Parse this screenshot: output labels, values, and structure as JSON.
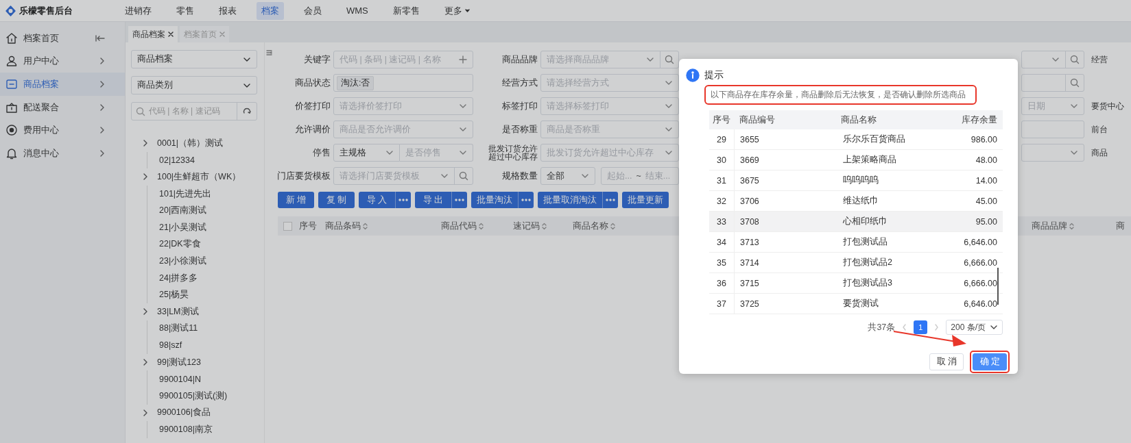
{
  "app": {
    "logo_text": "乐檬零售后台"
  },
  "top_nav": [
    {
      "label": "进销存",
      "selected": false,
      "kind": "link"
    },
    {
      "label": "零售",
      "selected": false,
      "kind": "link"
    },
    {
      "label": "报表",
      "selected": false,
      "kind": "link"
    },
    {
      "label": "档案",
      "selected": true,
      "kind": "link"
    },
    {
      "label": "会员",
      "selected": false,
      "kind": "link"
    },
    {
      "label": "WMS",
      "selected": false,
      "kind": "link"
    },
    {
      "label": "新零售",
      "selected": false,
      "kind": "link"
    },
    {
      "label": "更多",
      "selected": false,
      "kind": "dropdown"
    }
  ],
  "sidebar": {
    "items": [
      {
        "label": "档案首页",
        "selected": false,
        "kind": "collapse"
      },
      {
        "label": "用户中心",
        "selected": false,
        "kind": "menu"
      },
      {
        "label": "商品档案",
        "selected": true,
        "kind": "menu"
      },
      {
        "label": "配送聚合",
        "selected": false,
        "kind": "menu"
      },
      {
        "label": "费用中心",
        "selected": false,
        "kind": "menu"
      },
      {
        "label": "消息中心",
        "selected": false,
        "kind": "menu"
      }
    ]
  },
  "tabs": [
    {
      "label": "商品档案",
      "selected": true
    },
    {
      "label": "档案首页",
      "selected": false
    }
  ],
  "tree_panel": {
    "selects": [
      "商品档案",
      "商品类别"
    ],
    "search_placeholder": "代码 | 名称 | 速记码",
    "nodes": [
      {
        "label": "0001|（韩）测试",
        "has_children": true
      },
      {
        "label": "02|12334",
        "has_children": false
      },
      {
        "label": "100|生鲜超市（WK）",
        "has_children": true
      },
      {
        "label": "101|先进先出",
        "has_children": false
      },
      {
        "label": "20|西南测试",
        "has_children": false
      },
      {
        "label": "21|小吴测试",
        "has_children": false
      },
      {
        "label": "22|DK零食",
        "has_children": false
      },
      {
        "label": "23|小徐测试",
        "has_children": false
      },
      {
        "label": "24|拼多多",
        "has_children": false
      },
      {
        "label": "25|杨昊",
        "has_children": false
      },
      {
        "label": "33|LM测试",
        "has_children": true
      },
      {
        "label": "88|测试11",
        "has_children": false
      },
      {
        "label": "98|szf",
        "has_children": false
      },
      {
        "label": "99|测试123",
        "has_children": true
      },
      {
        "label": "9900104|N",
        "has_children": false
      },
      {
        "label": "9900105|测试(测)",
        "has_children": false
      },
      {
        "label": "9900106|食品",
        "has_children": true
      },
      {
        "label": "9900108|南京",
        "has_children": false
      }
    ]
  },
  "filter_rows": [
    {
      "left": {
        "label": "关键字",
        "kind": "text_add",
        "placeholder": "代码 | 条码 | 速记码 | 名称"
      },
      "right": {
        "label": "商品品牌",
        "kind": "select",
        "placeholder": "请选择商品品牌",
        "search": true
      },
      "edge_field": {
        "kind": "select",
        "search": true
      },
      "edge_label": "经营"
    },
    {
      "left": {
        "label": "商品状态",
        "kind": "tag",
        "value": "淘汰:否"
      },
      "right": {
        "label": "经营方式",
        "kind": "select",
        "placeholder": "请选择经营方式",
        "search": false
      },
      "edge_field": {
        "kind": "input",
        "search": true
      }
    },
    {
      "left": {
        "label": "价签打印",
        "kind": "select",
        "placeholder": "请选择价签打印",
        "search": false
      },
      "right": {
        "label": "标签打印",
        "kind": "select",
        "placeholder": "请选择标签打印",
        "search": false
      },
      "edge_field": {
        "kind": "select",
        "placeholder": "日期",
        "search": false
      },
      "edge_label": "要货中心"
    },
    {
      "left": {
        "label": "允许调价",
        "kind": "select",
        "placeholder": "商品是否允许调价",
        "search": false
      },
      "right": {
        "label": "是否称重",
        "kind": "select",
        "placeholder": "商品是否称重",
        "search": false
      },
      "edge_field": {
        "kind": "input",
        "search": false
      },
      "edge_label": "前台"
    },
    {
      "left": {
        "label": "停售",
        "kind": "dual_select",
        "value": "主规格",
        "placeholder": "是否停售"
      },
      "right": {
        "label": "批发订货允许超过中心库存",
        "kind": "select",
        "placeholder": "批发订货允许超过中心库存",
        "search": false
      },
      "edge_field": {
        "kind": "select",
        "search": false
      },
      "edge_label": "商品"
    },
    {
      "left": {
        "label": "门店要货模板",
        "kind": "select",
        "placeholder": "请选择门店要货模板",
        "search": true
      },
      "right": {
        "label": "规格数量",
        "kind": "range_select",
        "value": "全部",
        "start_placeholder": "起始...",
        "end_placeholder": "结束...",
        "separator": "~"
      }
    }
  ],
  "actions": [
    {
      "label": "新增",
      "more": false
    },
    {
      "label": "复制",
      "more": false
    },
    {
      "label": "导入",
      "more": true
    },
    {
      "label": "导出",
      "more": true
    },
    {
      "label": "批量淘汰",
      "more": true
    },
    {
      "label": "批量取消淘汰",
      "more": true
    },
    {
      "label": "批量更新",
      "more": false
    }
  ],
  "grid": {
    "select_all_checked": false,
    "columns": [
      {
        "label": "序号",
        "sortable": false
      },
      {
        "label": "商品条码",
        "sortable": true
      },
      {
        "label": "商品代码",
        "sortable": true
      },
      {
        "label": "速记码",
        "sortable": true
      },
      {
        "label": "商品名称",
        "sortable": true
      },
      {
        "label": "商品品牌",
        "sortable": true
      },
      {
        "label": "商",
        "sortable": false
      }
    ]
  },
  "dialog": {
    "title": "提示",
    "message": "以下商品存在库存余量，商品删除后无法恢复，是否确认删除所选商品",
    "message_annotated": true,
    "columns": [
      "序号",
      "商品编号",
      "商品名称",
      "库存余量"
    ],
    "rows": [
      {
        "cells": [
          "29",
          "3655",
          "乐尔乐百货商品",
          "986.00"
        ],
        "highlighted": false
      },
      {
        "cells": [
          "30",
          "3669",
          "上架策略商品",
          "48.00"
        ],
        "highlighted": false
      },
      {
        "cells": [
          "31",
          "3675",
          "呜呜呜呜",
          "14.00"
        ],
        "highlighted": false
      },
      {
        "cells": [
          "32",
          "3706",
          "维达纸巾",
          "45.00"
        ],
        "highlighted": false
      },
      {
        "cells": [
          "33",
          "3708",
          "心相印纸巾",
          "95.00"
        ],
        "highlighted": true
      },
      {
        "cells": [
          "34",
          "3713",
          "打包测试品",
          "6,646.00"
        ],
        "highlighted": false
      },
      {
        "cells": [
          "35",
          "3714",
          "打包测试品2",
          "6,666.00"
        ],
        "highlighted": false
      },
      {
        "cells": [
          "36",
          "3715",
          "打包测试品3",
          "6,666.00"
        ],
        "highlighted": false
      },
      {
        "cells": [
          "37",
          "3725",
          "要货测试",
          "6,646.00"
        ],
        "highlighted": false
      }
    ],
    "total": "共37条",
    "pages": [
      {
        "label": "1",
        "selected": true
      }
    ],
    "page_size": "200 条/页",
    "buttons": [
      {
        "label": "取消",
        "kind": "default",
        "annotated": false
      },
      {
        "label": "确定",
        "kind": "primary",
        "annotated": true
      }
    ]
  }
}
